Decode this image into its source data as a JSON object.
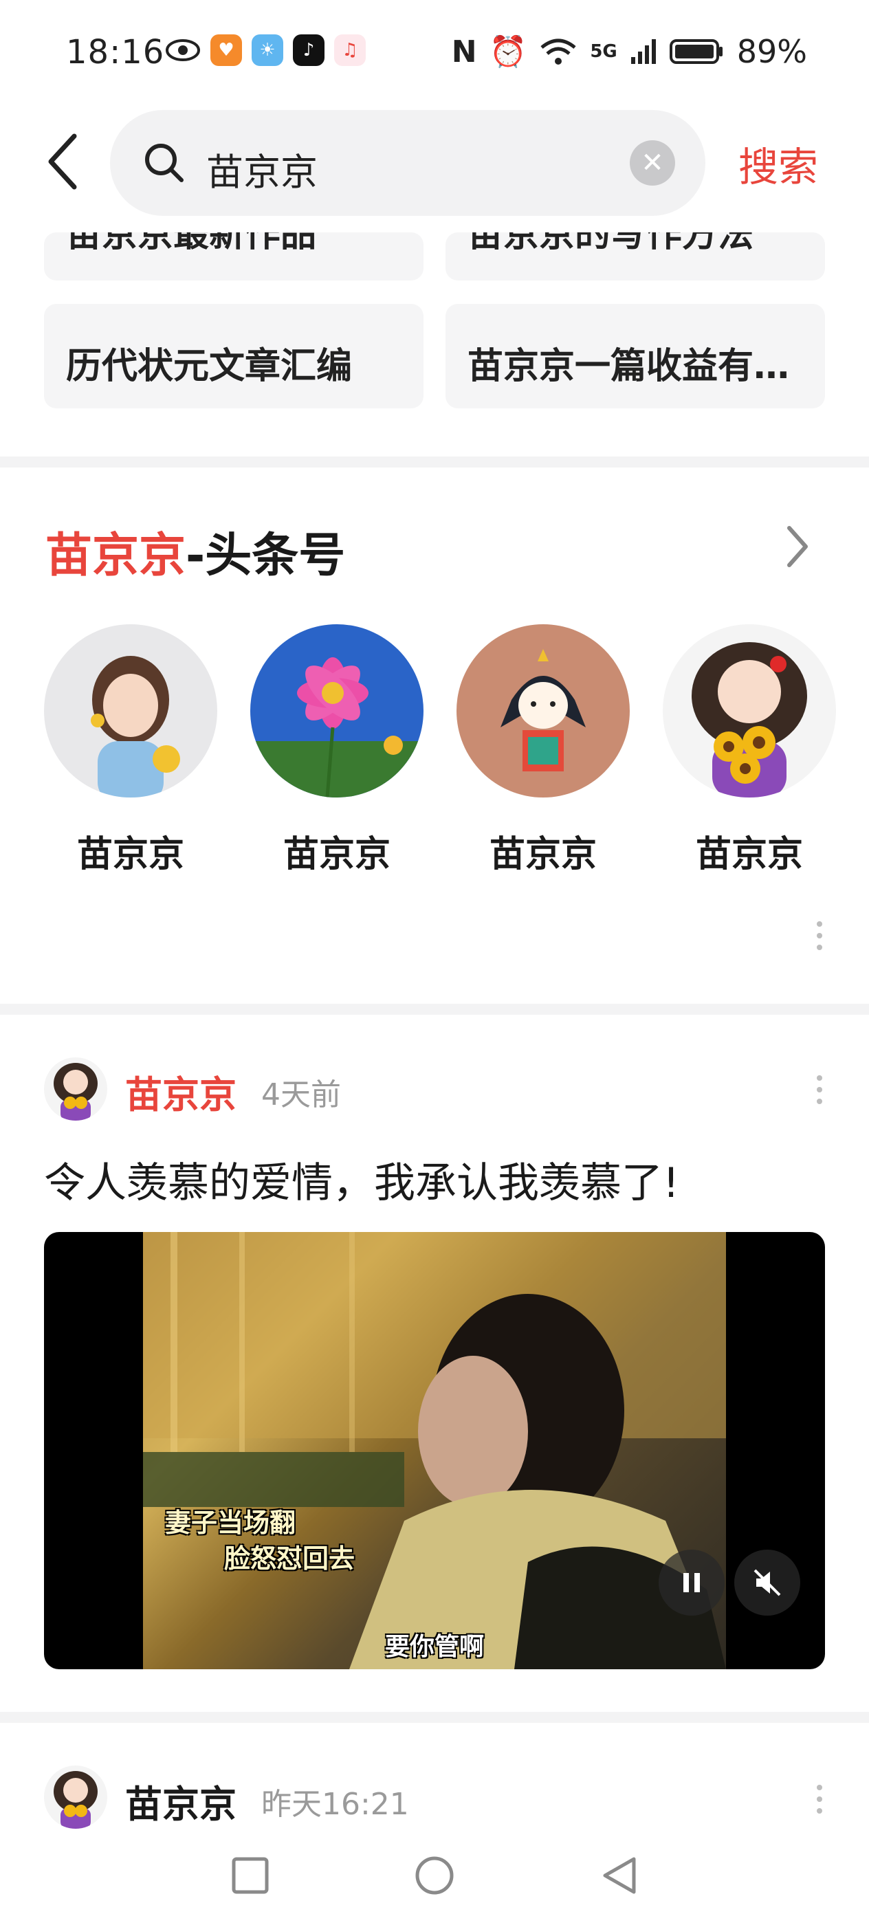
{
  "status_bar": {
    "time": "18:16",
    "network": "5G",
    "battery": "89%"
  },
  "search": {
    "query": "苗京京",
    "submit_label": "搜索"
  },
  "suggestions": [
    "苗京京最新作品",
    "苗京京的写作方法",
    "历代状元文章汇编",
    "苗京京一篇收益有…"
  ],
  "accounts_section": {
    "title_highlight": "苗京京",
    "title_suffix": "-头条号",
    "accounts": [
      {
        "name": "苗京京"
      },
      {
        "name": "苗京京"
      },
      {
        "name": "苗京京"
      },
      {
        "name": "苗京京"
      }
    ]
  },
  "posts": [
    {
      "author": "苗京京",
      "time": "4天前",
      "text": "令人羡慕的爱情，我承认我羡慕了!",
      "video": {
        "caption_line1": "妻子当场翻",
        "caption_line2": "脸怒怼回去",
        "caption_bottom": "要你管啊"
      }
    },
    {
      "author": "苗京京",
      "time": "昨天16:21"
    }
  ],
  "colors": {
    "accent": "#e8453c"
  }
}
